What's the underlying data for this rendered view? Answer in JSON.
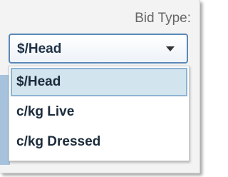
{
  "bid_type": {
    "label": "Bid Type:",
    "selected_value": "$/Head",
    "options": [
      {
        "label": "$/Head",
        "selected": true
      },
      {
        "label": "c/kg Live",
        "selected": false
      },
      {
        "label": "c/kg Dressed",
        "selected": false
      }
    ]
  },
  "colors": {
    "select_border": "#5a88b8",
    "selected_option_bg": "#d2e4ee",
    "label_text": "#666666"
  }
}
